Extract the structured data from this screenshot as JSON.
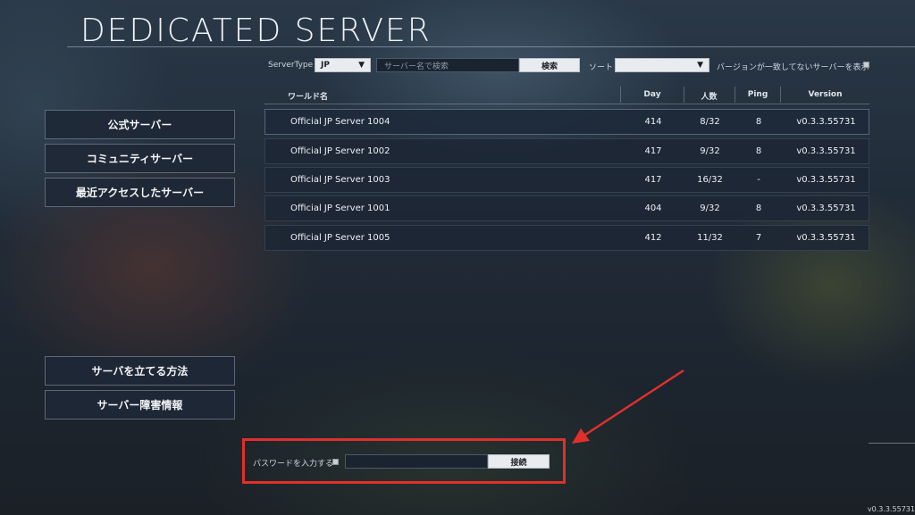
{
  "page": {
    "title": "DEDICATED SERVER"
  },
  "filters": {
    "server_type_label": "ServerType",
    "server_type_value": "JP",
    "search_placeholder": "サーバー名で検索",
    "search_button": "検索",
    "sort_label": "ソート",
    "sort_value": "",
    "version_mismatch_label": "バージョンが一致してないサーバーを表示"
  },
  "table": {
    "columns": [
      "ワールド名",
      "Day",
      "人数",
      "Ping",
      "Version"
    ],
    "rows": [
      {
        "name": "Official JP Server 1004",
        "day": "414",
        "players": "8/32",
        "ping": "8",
        "version": "v0.3.3.55731"
      },
      {
        "name": "Official JP Server 1002",
        "day": "417",
        "players": "9/32",
        "ping": "8",
        "version": "v0.3.3.55731"
      },
      {
        "name": "Official JP Server 1003",
        "day": "417",
        "players": "16/32",
        "ping": "-",
        "version": "v0.3.3.55731"
      },
      {
        "name": "Official JP Server 1001",
        "day": "404",
        "players": "9/32",
        "ping": "8",
        "version": "v0.3.3.55731"
      },
      {
        "name": "Official JP Server 1005",
        "day": "412",
        "players": "11/32",
        "ping": "7",
        "version": "v0.3.3.55731"
      }
    ]
  },
  "sidebar": {
    "items": [
      "公式サーバー",
      "コミュニティサーバー",
      "最近アクセスしたサーバー"
    ],
    "help_items": [
      "サーバを立てる方法",
      "サーバー障害情報"
    ]
  },
  "connect": {
    "password_label": "パスワードを入力する",
    "connect_button": "接続"
  },
  "footer": {
    "version": "v0.3.3.55731"
  },
  "colors": {
    "highlight": "#e0302c",
    "panel": "#1c2634",
    "light_button": "#e9ecef"
  }
}
